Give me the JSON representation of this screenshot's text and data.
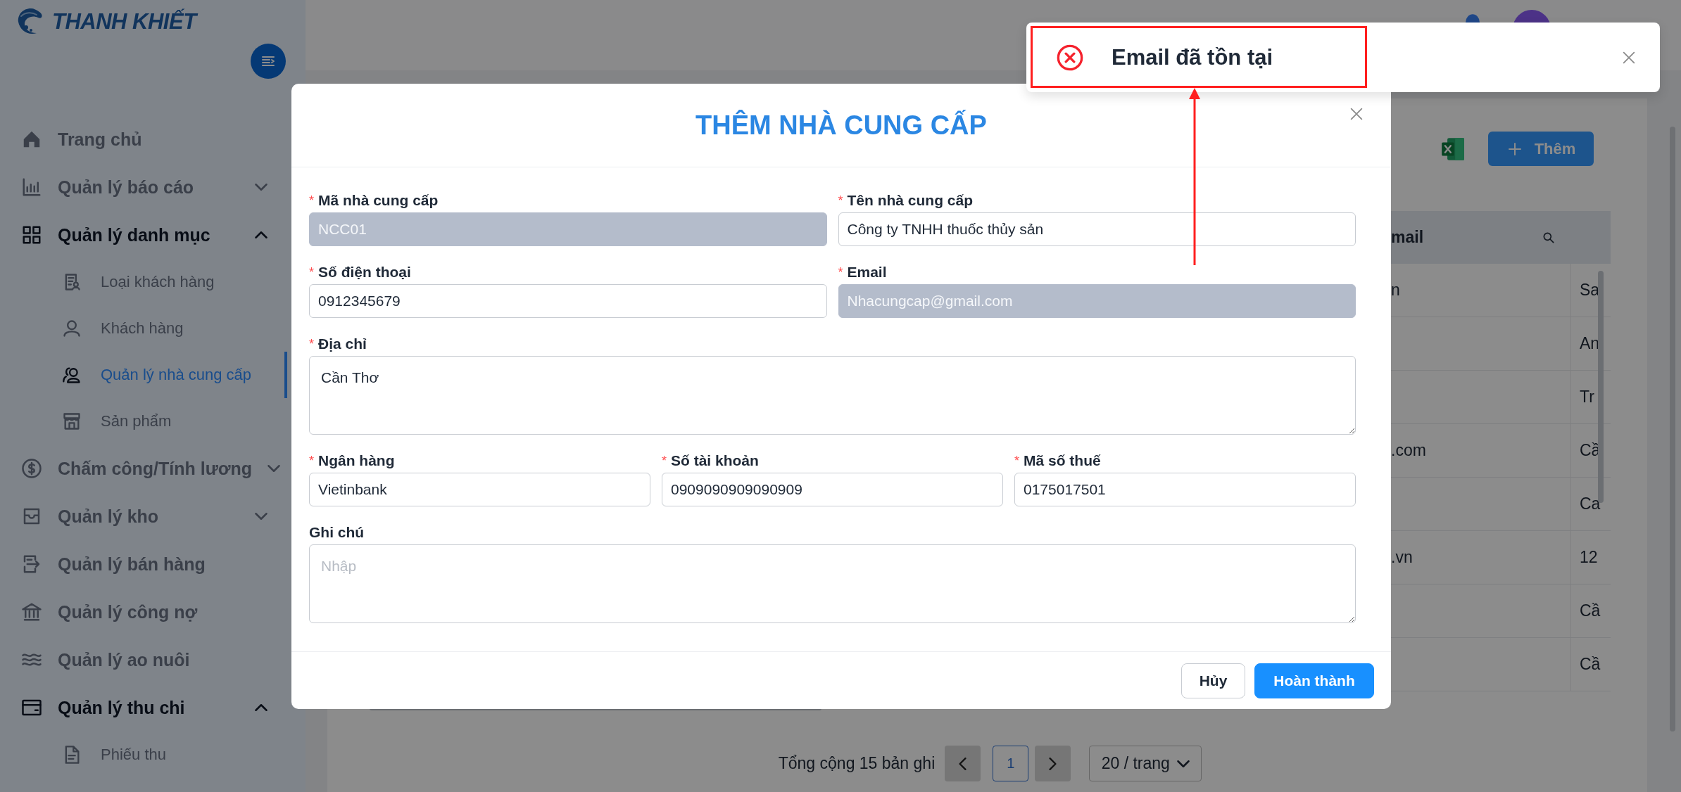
{
  "sidebar": {
    "logo": "THANH KHIẾT",
    "items": [
      {
        "label": "Trang chủ",
        "selected": false
      },
      {
        "label": "Quản lý báo cáo",
        "selected": false,
        "expanded": false
      },
      {
        "label": "Quản lý danh mục",
        "selected": false,
        "expanded": true,
        "children": [
          {
            "label": "Loại khách hàng",
            "selected": false
          },
          {
            "label": "Khách hàng",
            "selected": false
          },
          {
            "label": "Quản lý nhà cung cấp",
            "selected": true
          },
          {
            "label": "Sản phẩm",
            "selected": false
          }
        ]
      },
      {
        "label": "Chấm công/Tính lương",
        "selected": false,
        "expanded": false
      },
      {
        "label": "Quản lý kho",
        "selected": false,
        "expanded": false
      },
      {
        "label": "Quản lý bán hàng",
        "selected": false
      },
      {
        "label": "Quản lý công nợ",
        "selected": false
      },
      {
        "label": "Quản lý ao nuôi",
        "selected": false
      },
      {
        "label": "Quản lý thu chi",
        "selected": false,
        "expanded": true,
        "children": [
          {
            "label": "Phiếu thu",
            "selected": false
          }
        ]
      }
    ]
  },
  "toolbar": {
    "add_button": "Thêm"
  },
  "table": {
    "columns": [
      {
        "label": "mail"
      }
    ],
    "rows": [
      {
        "column_1": "n",
        "column_2": "Sa"
      },
      {
        "column_2": "An"
      },
      {
        "column_2": "Tr"
      },
      {
        "column_1": ".com",
        "column_2": "Cầ"
      },
      {
        "column_2": "Ca"
      },
      {
        "column_1": ".vn",
        "column_2": "12"
      },
      {
        "column_2": "Cầ"
      },
      {
        "column_2": "Cầ"
      }
    ]
  },
  "pagination": {
    "total": "Tổng cộng 15 bản ghi",
    "pages": [
      {
        "label": "1",
        "selected": true
      }
    ],
    "page_size": "20 / trang"
  },
  "modal": {
    "title": "THÊM NHÀ CUNG CẤP",
    "rows": [
      {
        "fields": [
          {
            "mark": "*",
            "label": "Mã nhà cung cấp",
            "kind": "input",
            "value": "NCC01",
            "disabled": true
          },
          {
            "mark": "*",
            "label": "Tên nhà cung cấp",
            "kind": "input",
            "value": "Công ty TNHH thuốc thủy sản",
            "disabled": false
          }
        ]
      },
      {
        "fields": [
          {
            "mark": "*",
            "label": "Số điện thoại",
            "kind": "input",
            "value": "0912345679",
            "disabled": false
          },
          {
            "mark": "*",
            "label": "Email",
            "kind": "input",
            "value": "Nhacungcap@gmail.com",
            "disabled": true
          }
        ]
      },
      {
        "fields": [
          {
            "mark": "*",
            "label": "Địa chỉ",
            "kind": "textarea",
            "value": "Cần Thơ",
            "disabled": false
          }
        ]
      },
      {
        "fields": [
          {
            "mark": "*",
            "label": "Ngân hàng",
            "kind": "input",
            "value": "Vietinbank",
            "disabled": false
          },
          {
            "mark": "*",
            "label": "Số tài khoản",
            "kind": "input",
            "value": "0909090909090909",
            "disabled": false
          },
          {
            "mark": "*",
            "label": "Mã số thuế",
            "kind": "input",
            "value": "0175017501",
            "disabled": false
          }
        ]
      },
      {
        "fields": [
          {
            "label": "Ghi chú",
            "kind": "textarea",
            "placeholder": "Nhập",
            "disabled": false
          }
        ]
      }
    ],
    "buttons": [
      {
        "label": "Hủy",
        "kind": "default"
      },
      {
        "label": "Hoàn thành",
        "kind": "primary"
      }
    ]
  },
  "toast": {
    "kind": "error",
    "message": "Email đã tồn tại"
  }
}
